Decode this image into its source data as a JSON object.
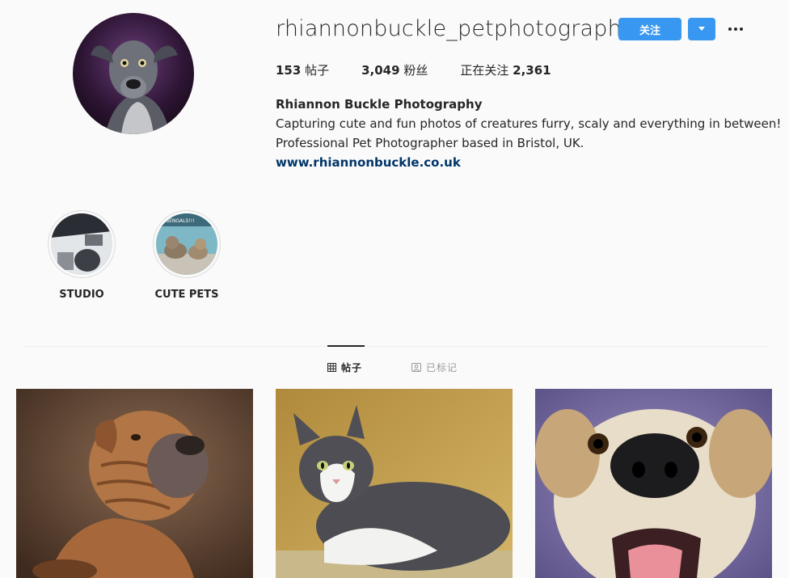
{
  "profile": {
    "username": "rhiannonbuckle_petphotography",
    "follow_label": "关注",
    "stats": {
      "posts_count": "153",
      "posts_label": "帖子",
      "followers_count": "3,049",
      "followers_label": "粉丝",
      "following_label": "正在关注",
      "following_count": "2,361"
    },
    "full_name": "Rhiannon Buckle Photography",
    "bio_line1": "Capturing cute and fun photos of creatures furry, scaly and everything in between!",
    "bio_line2": "Professional Pet Photographer based in Bristol, UK.",
    "website": "www.rhiannonbuckle.co.uk"
  },
  "highlights": [
    {
      "label": "STUDIO",
      "icon": "studio-thumbnail"
    },
    {
      "label": "CUTE PETS",
      "icon": "cats-thumbnail",
      "thumb_text": "BENGALS!!!"
    }
  ],
  "tabs": [
    {
      "label": "帖子",
      "icon": "grid-icon",
      "active": true
    },
    {
      "label": "已标记",
      "icon": "tagged-icon",
      "active": false
    }
  ],
  "posts": [
    {
      "subject": "shar-pei dog"
    },
    {
      "subject": "black and white cat"
    },
    {
      "subject": "dog nose close-up"
    }
  ],
  "colors": {
    "accent": "#3897f0",
    "link": "#003569",
    "background": "#fafafa"
  }
}
